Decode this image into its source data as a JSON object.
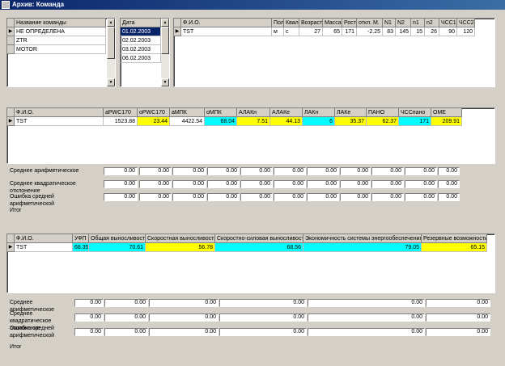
{
  "window": {
    "title": "Архив: Команда"
  },
  "teams": {
    "header": "Название команды",
    "items": [
      "НЕ ОПРЕДЕЛЕНА",
      "ZTR",
      "MOTOR"
    ]
  },
  "dates": {
    "header": "Дата",
    "items": [
      "01.02.2003",
      "02.02.2003",
      "03.02.2003",
      "06.02.2003"
    ]
  },
  "athletes": {
    "headers": [
      "Ф.И.О.",
      "Пол",
      "Квал.",
      "Возраст",
      "Масса",
      "Рост",
      "откл. М.",
      "N1",
      "N2",
      "n1",
      "n2",
      "ЧСС1",
      "ЧСС2"
    ],
    "rows": [
      [
        "TST",
        "м",
        "с",
        "27",
        "65",
        "171",
        "-2.25",
        "83",
        "145",
        "15",
        "26",
        "90",
        "120"
      ]
    ]
  },
  "table2": {
    "headers": [
      "Ф.И.О.",
      "aPWC170",
      "oPWC170",
      "аМПК",
      "оМПК",
      "АЛАКн",
      "АЛАКе",
      "ЛАКн",
      "ЛАКе",
      "ПАНО",
      "ЧССпано",
      "ОМЕ"
    ],
    "rows": [
      [
        "TST",
        "1523.88",
        "23.44",
        "4422.54",
        "68.04",
        "7.51",
        "44.13",
        "6",
        "35.37",
        "62.37",
        "171",
        "209.91"
      ]
    ],
    "highlight": [
      "",
      "",
      "yellow",
      "",
      "cyan",
      "yellow",
      "yellow",
      "cyan",
      "yellow",
      "yellow",
      "cyan",
      "yellow"
    ]
  },
  "stats2": {
    "labels": [
      "Среднее арифметическое",
      "Среднее квадратическое отклонение",
      "Ошибка средней арифметической"
    ],
    "itog": "Итог",
    "values": [
      [
        "0.00",
        "0.00",
        "0.00",
        "0.00",
        "0.00",
        "0.00",
        "0.00",
        "0.00",
        "0.00",
        "0.00",
        "0.00"
      ],
      [
        "0.00",
        "0.00",
        "0.00",
        "0.00",
        "0.00",
        "0.00",
        "0.00",
        "0.00",
        "0.00",
        "0.00",
        "0.00"
      ],
      [
        "0.00",
        "0.00",
        "0.00",
        "0.00",
        "0.00",
        "0.00",
        "0.00",
        "0.00",
        "0.00",
        "0.00",
        "0.00"
      ]
    ]
  },
  "table3": {
    "headers": [
      "Ф.И.О.",
      "УФП",
      "Общая выносливость",
      "Скоростная выносливость",
      "Скоростно-силовая выносливость",
      "Экономичность системы энергообеспечения",
      "Резервные возможности"
    ],
    "rows": [
      [
        "TST",
        "68.35",
        "70.61",
        "56.78",
        "68.56",
        "79.05",
        "65.15"
      ]
    ],
    "highlight": [
      "",
      "cyan",
      "cyan",
      "yellow",
      "cyan",
      "cyan",
      "yellow"
    ]
  },
  "stats3": {
    "labels": [
      "Среднее арифметическое",
      "Среднее квадратическое отклонение",
      "Ошибка средней арифметической"
    ],
    "itog": "Итог",
    "values": [
      [
        "0.00",
        "0.00",
        "0.00",
        "0.00",
        "0.00",
        "0.00"
      ],
      [
        "0.00",
        "0.00",
        "0.00",
        "0.00",
        "0.00",
        "0.00"
      ],
      [
        "0.00",
        "0.00",
        "0.00",
        "0.00",
        "0.00",
        "0.00"
      ]
    ]
  },
  "colors": {
    "yellow": "#ffff00",
    "cyan": "#00ffff",
    "selection": "#0a246a",
    "titlebar": "#0a246a"
  },
  "icons": {
    "row_indicator": "triangle-right-icon",
    "scroll_up": "arrow-up-icon",
    "scroll_down": "arrow-down-icon",
    "window": "app-icon"
  }
}
